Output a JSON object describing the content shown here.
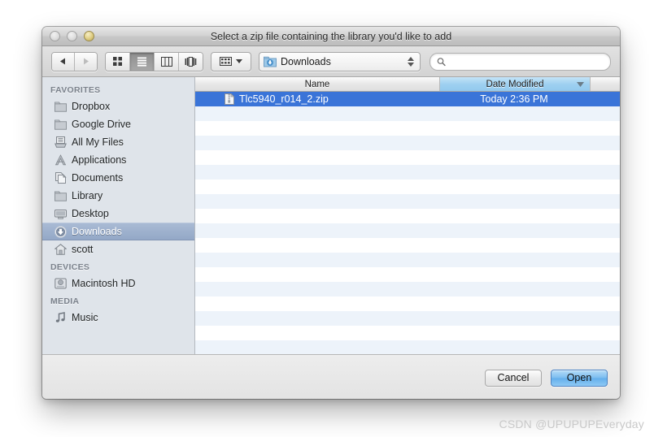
{
  "window": {
    "title": "Select a zip file containing the library you'd like to add",
    "traffic_lights": [
      "close-button",
      "minimize-button",
      "zoom-button"
    ]
  },
  "toolbar": {
    "nav": {
      "back": "back-arrow",
      "forward": "forward-arrow"
    },
    "view_modes": [
      {
        "name": "icon-view",
        "selected": false
      },
      {
        "name": "list-view",
        "selected": true
      },
      {
        "name": "column-view",
        "selected": false
      },
      {
        "name": "coverflow-view",
        "selected": false
      }
    ],
    "arrange_label": "arrange-by",
    "path_popup": {
      "label": "Downloads",
      "icon": "downloads-folder-icon"
    },
    "search": {
      "value": "",
      "placeholder": ""
    }
  },
  "sidebar": {
    "sections": [
      {
        "header": "FAVORITES",
        "items": [
          {
            "label": "Dropbox",
            "icon": "folder-icon",
            "selected": false
          },
          {
            "label": "Google Drive",
            "icon": "folder-icon",
            "selected": false
          },
          {
            "label": "All My Files",
            "icon": "all-my-files-icon",
            "selected": false
          },
          {
            "label": "Applications",
            "icon": "applications-icon",
            "selected": false
          },
          {
            "label": "Documents",
            "icon": "documents-icon",
            "selected": false
          },
          {
            "label": "Library",
            "icon": "folder-icon",
            "selected": false
          },
          {
            "label": "Desktop",
            "icon": "desktop-icon",
            "selected": false
          },
          {
            "label": "Downloads",
            "icon": "downloads-icon",
            "selected": true
          },
          {
            "label": "scott",
            "icon": "home-icon",
            "selected": false
          }
        ]
      },
      {
        "header": "DEVICES",
        "items": [
          {
            "label": "Macintosh HD",
            "icon": "hard-disk-icon",
            "selected": false
          }
        ]
      },
      {
        "header": "MEDIA",
        "items": [
          {
            "label": "Music",
            "icon": "music-note-icon",
            "selected": false
          }
        ]
      }
    ]
  },
  "file_list": {
    "columns": [
      {
        "label": "Name",
        "sorted": false
      },
      {
        "label": "Date Modified",
        "sorted": true,
        "sort_direction": "descending"
      }
    ],
    "rows": [
      {
        "name": "Tlc5940_r014_2.zip",
        "date_modified": "Today 2:36 PM",
        "icon": "zip-file-icon",
        "selected": true
      }
    ],
    "empty_row_count": 17
  },
  "footer": {
    "cancel_label": "Cancel",
    "open_label": "Open"
  },
  "watermark": {
    "text": "CSDN @UPUPUPEveryday"
  },
  "colors": {
    "selection_blue": "#3a74d8",
    "sort_header_blue": "#9ed0f0",
    "sidebar_bg": "#dfe4ea",
    "sidebar_selection": "#93a8c7",
    "default_button_blue": "#7cbdf0"
  }
}
